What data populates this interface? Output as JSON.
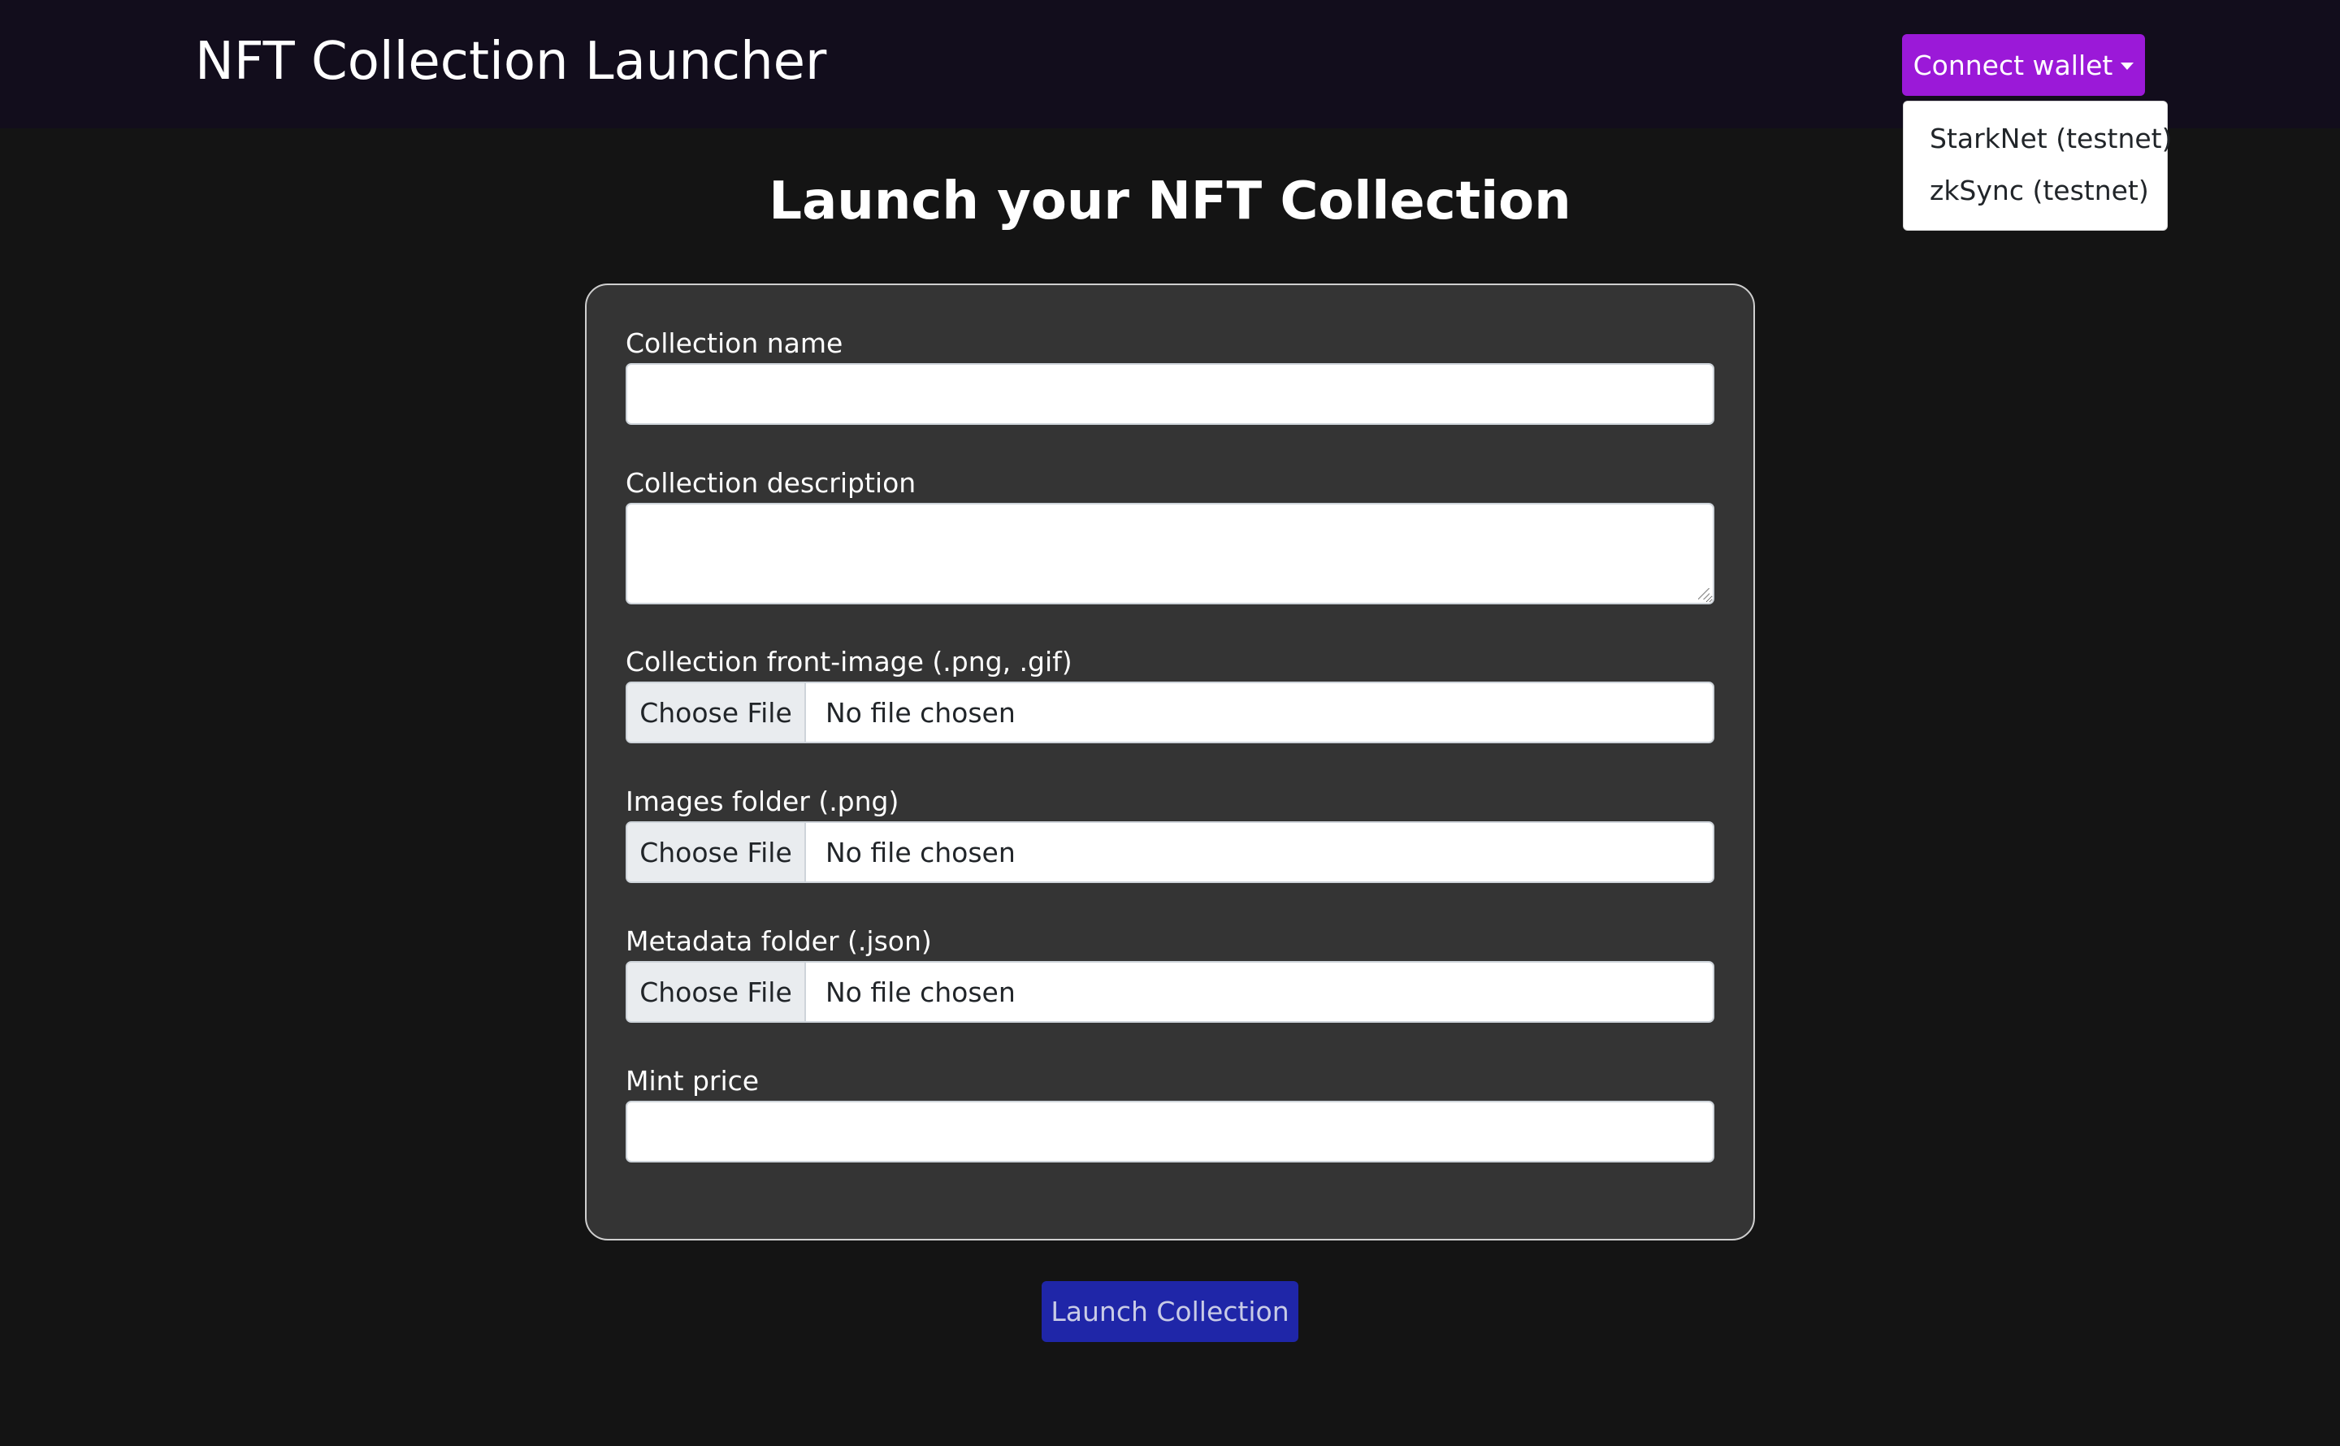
{
  "navbar": {
    "brand": "NFT Collection Launcher",
    "wallet_button_label": "Connect wallet",
    "wallet_menu": [
      {
        "label": "StarkNet (testnet)"
      },
      {
        "label": "zkSync (testnet)"
      }
    ]
  },
  "main": {
    "heading": "Launch your NFT Collection",
    "form": {
      "collection_name": {
        "label": "Collection name",
        "value": ""
      },
      "collection_description": {
        "label": "Collection description",
        "value": ""
      },
      "front_image": {
        "label": "Collection front-image (.png, .gif)",
        "button": "Choose File",
        "status": "No file chosen"
      },
      "images_folder": {
        "label": "Images folder (.png)",
        "button": "Choose File",
        "status": "No file chosen"
      },
      "metadata_folder": {
        "label": "Metadata folder (.json)",
        "button": "Choose File",
        "status": "No file chosen"
      },
      "mint_price": {
        "label": "Mint price",
        "value": ""
      }
    },
    "submit_label": "Launch Collection"
  },
  "colors": {
    "page_background": "#141414",
    "navbar_background": "#120d1c",
    "wallet_button": "#9b19d8",
    "card_background": "#343434",
    "launch_button": "#1f26a8"
  }
}
